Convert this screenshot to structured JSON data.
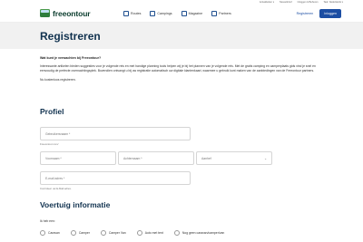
{
  "topbar": {
    "items": [
      "Actualiteiten ▾",
      "Nieuwsbrief",
      "Inloggen & Beheren",
      "Taal: Nederlands ▾"
    ]
  },
  "header": {
    "logo_text": "freeontour",
    "nav": [
      {
        "label": "Routes",
        "icon": "route-icon"
      },
      {
        "label": "Campings",
        "icon": "tent-icon"
      },
      {
        "label": "Magazine",
        "icon": "magazine-icon"
      },
      {
        "label": "Partners",
        "icon": "handshake-icon"
      }
    ],
    "register_label": "Registreren",
    "login_label": "Inloggen"
  },
  "page": {
    "title": "Registreren",
    "question": "Wat kunt je verwachten bij Freeontour?",
    "intro": "Interessante artikelen bieden suggesties voor je volgende reis en met handige planning tools helpen wij je bij het plannen van je volgende reis. Met de gratis camping en camperplaats gids vind je snel en eenvoudig de perfecte overnachtingsplek. Bovendien ontvangt u bij uw registratie automatisch uw digitale klantenkaart, waarmee u gebruik kunt maken van de aanbiedingen van de Freeontour partners.",
    "note": "Nu kostenloos registreren."
  },
  "profile": {
    "title": "Profiel",
    "username_placeholder": "Gebruikersnaam *",
    "username_help": "Freeontour.com/",
    "firstname_placeholder": "Voornaam *",
    "lastname_placeholder": "Achternaam *",
    "gender_placeholder": "Aanhef",
    "email_placeholder": "E-mail adres *",
    "email_help": "Controleer uw E-Mail adres."
  },
  "vehicle": {
    "title": "Voertuig informatie",
    "question": "Ik heb een:",
    "options": [
      "Caravan",
      "Camper",
      "Camper Van",
      "Auto met tent",
      "Nog geen caravan/camper/van"
    ]
  }
}
